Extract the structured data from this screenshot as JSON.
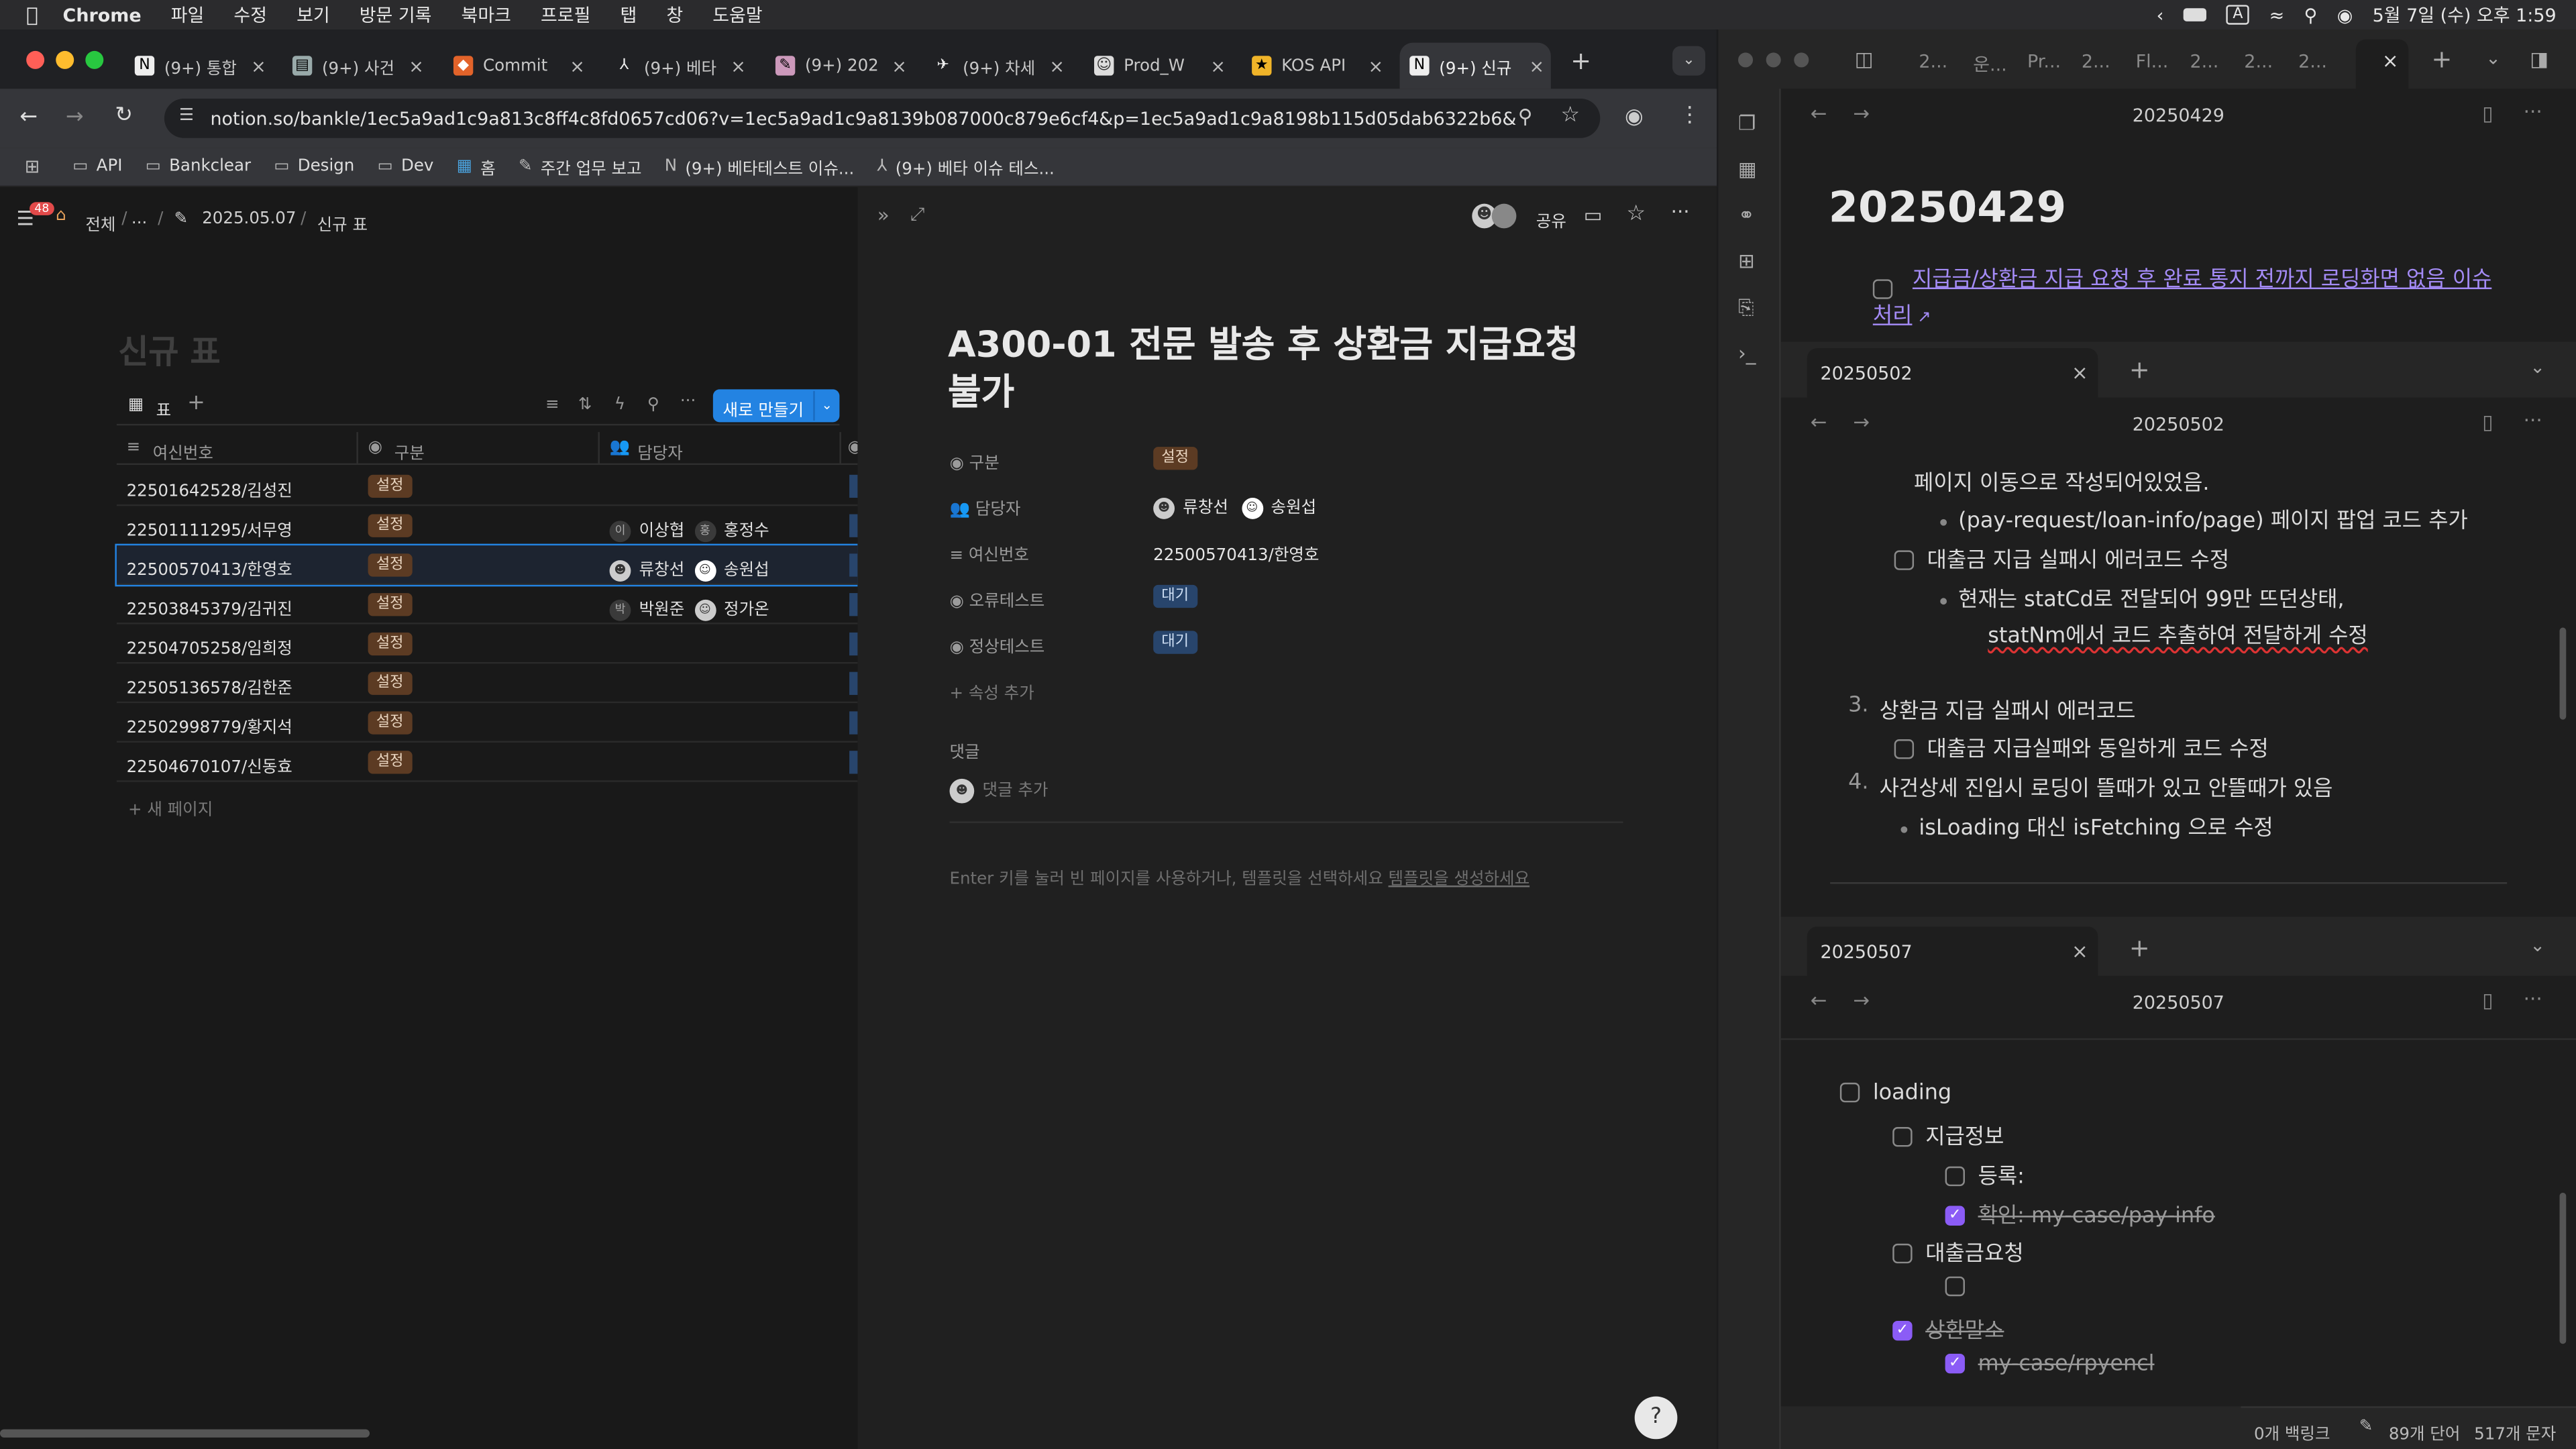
{
  "menubar": {
    "app": "Chrome",
    "items": [
      "파일",
      "수정",
      "보기",
      "방문 기록",
      "북마크",
      "프로필",
      "탭",
      "창",
      "도움말"
    ],
    "ime": "A",
    "clock": "5월 7일 (수) 오후 1:59"
  },
  "chrome": {
    "tabs": [
      "(9+) 통합",
      "(9+) 사건",
      "Commit",
      "(9+) 베타",
      "(9+) 202",
      "(9+) 차세",
      "Prod_W",
      "KOS API",
      "(9+) 신규"
    ],
    "url": "notion.so/bankle/1ec5a9ad1c9a813c8ff4c8fd0657cd06?v=1ec5a9ad1c9a8139b087000c879e6cf4&p=1ec5a9ad1c9a8198b115d05dab6322b6&...",
    "bookmarks": [
      "API",
      "Bankclear",
      "Design",
      "Dev",
      "홈",
      "주간 업무 보고",
      "(9+) 베타테스트 이슈...",
      "(9+) 베타 이슈 테스..."
    ]
  },
  "notion": {
    "breadcrumb": {
      "badge": "48",
      "all": "전체",
      "ellipsis": "...",
      "date": "2025.05.07",
      "page": "신규 표"
    },
    "db_title": "신규 표",
    "view_label": "표",
    "new_button": "새로 만들기",
    "columns": [
      "여신번호",
      "구분",
      "담당자"
    ],
    "rows": [
      {
        "id": "22501642528/김성진",
        "type": "설정",
        "owners": []
      },
      {
        "id": "22501111295/서무영",
        "type": "설정",
        "owners": [
          "이상협",
          "홍정수"
        ]
      },
      {
        "id": "22500570413/한영호",
        "type": "설정",
        "owners": [
          "류창선",
          "송원섭"
        ]
      },
      {
        "id": "22503845379/김귀진",
        "type": "설정",
        "owners": [
          "박원준",
          "정가온"
        ]
      },
      {
        "id": "22504705258/임희정",
        "type": "설정",
        "owners": []
      },
      {
        "id": "22505136578/김한준",
        "type": "설정",
        "owners": []
      },
      {
        "id": "22502998779/황지석",
        "type": "설정",
        "owners": []
      },
      {
        "id": "22504670107/신동효",
        "type": "설정",
        "owners": []
      }
    ],
    "new_page": "새 페이지",
    "peek": {
      "share": "공유",
      "title": "A300-01 전문 발송 후 상환금 지급요청 불가",
      "props": [
        {
          "label": "구분",
          "value": "설정"
        },
        {
          "label": "담당자",
          "value": [
            "류창선",
            "송원섭"
          ]
        },
        {
          "label": "여신번호",
          "value": "22500570413/한영호"
        },
        {
          "label": "오류테스트",
          "value": "대기"
        },
        {
          "label": "정상테스트",
          "value": "대기"
        }
      ],
      "add_prop": "속성 추가",
      "comments_label": "댓글",
      "add_comment": "댓글 추가",
      "empty_hint": "Enter 키를 눌러 빈 페이지를 사용하거나, 템플릿을 선택하세요",
      "empty_link": "템플릿을 생성하세요"
    }
  },
  "obsidian": {
    "top_tabs": [
      "2...",
      "운...",
      "Pr...",
      "2...",
      "Fl...",
      "2...",
      "2...",
      "2..."
    ],
    "pane1": {
      "header": "20250429",
      "title": "20250429",
      "task": "지급금/상환금 지급 요청 후 완료 통지 전까지 로딩화면 없음 이슈 처리"
    },
    "pane2": {
      "tab": "20250502",
      "header": "20250502",
      "lines": [
        "페이지 이동으로 작성되어있었음.",
        "(pay-request/loan-info/page) 페이지 팝업 코드 추가",
        "대출금 지급 실패시 에러코드 수정",
        "현재는 statCd로 전달되어 99만 뜨던상태,",
        "statNm에서 코드 추출하여 전달하게 수정",
        "3.",
        "상환금 지급 실패시 에러코드",
        "대출금 지급실패와 동일하게 코드 수정",
        "4.",
        "사건상세 진입시 로딩이 뜰때가 있고 안뜰때가 있음",
        "isLoading 대신 isFetching 으로 수정"
      ]
    },
    "pane3": {
      "tab": "20250507",
      "header": "20250507",
      "lines": [
        "loading",
        "지급정보",
        "등록:",
        "확인: my-case/pay-info",
        "대출금요청",
        "",
        "상환말소",
        "my-case/rpyencl"
      ]
    },
    "status": {
      "backlinks": "0개 백링크",
      "words": "89개 단어",
      "chars": "517개 문자"
    }
  }
}
